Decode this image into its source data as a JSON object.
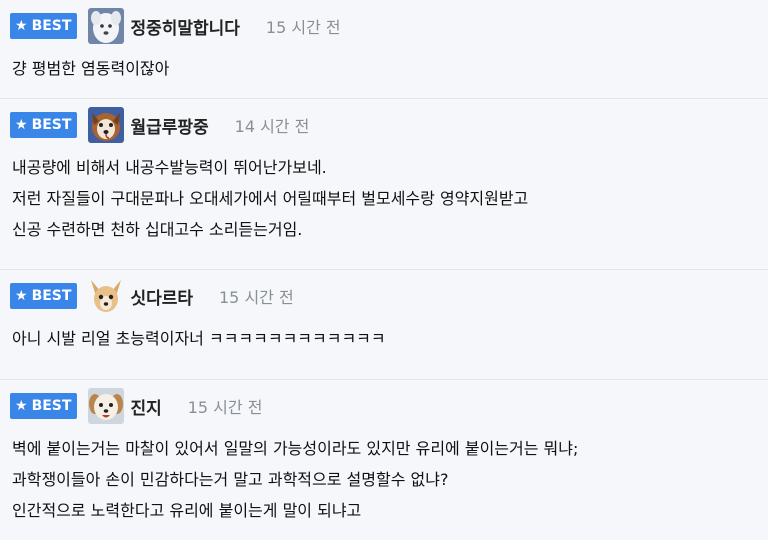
{
  "best_label": "BEST",
  "comments": [
    {
      "nickname": "정중히말합니다",
      "time": "15 시간 전",
      "avatar": "white-dog-avatar",
      "lines": [
        "걍 평범한 염동력이잖아"
      ]
    },
    {
      "nickname": "월급루팡중",
      "time": "14 시간 전",
      "avatar": "brown-dog-avatar",
      "lines": [
        "내공량에 비해서 내공수발능력이 뛰어난가보네.",
        "저런 자질들이 구대문파나 오대세가에서 어릴때부터 벌모세수랑 영약지원받고",
        "신공 수련하면 천하 십대고수 소리듣는거임."
      ]
    },
    {
      "nickname": "싯다르타",
      "time": "15 시간 전",
      "avatar": "chihuahua-avatar",
      "lines": [
        "아니 시발 리얼 초능력이자너 ㅋㅋㅋㅋㅋㅋㅋㅋㅋㅋㅋㅋ"
      ]
    },
    {
      "nickname": "진지",
      "time": "15 시간 전",
      "avatar": "puppy-avatar",
      "lines": [
        "벽에 붙이는거는 마찰이 있어서 일말의 가능성이라도 있지만 유리에 붙이는거는 뭐냐;",
        "과학쟁이들아 손이 민감하다는거 말고 과학적으로 설명할수 없냐?",
        "인간적으로 노력한다고 유리에 붙이는게 말이 되냐고"
      ]
    }
  ],
  "colors": {
    "best_badge": "#3a86e8",
    "background": "#f5f7fa",
    "time_text": "#8a8f96"
  }
}
